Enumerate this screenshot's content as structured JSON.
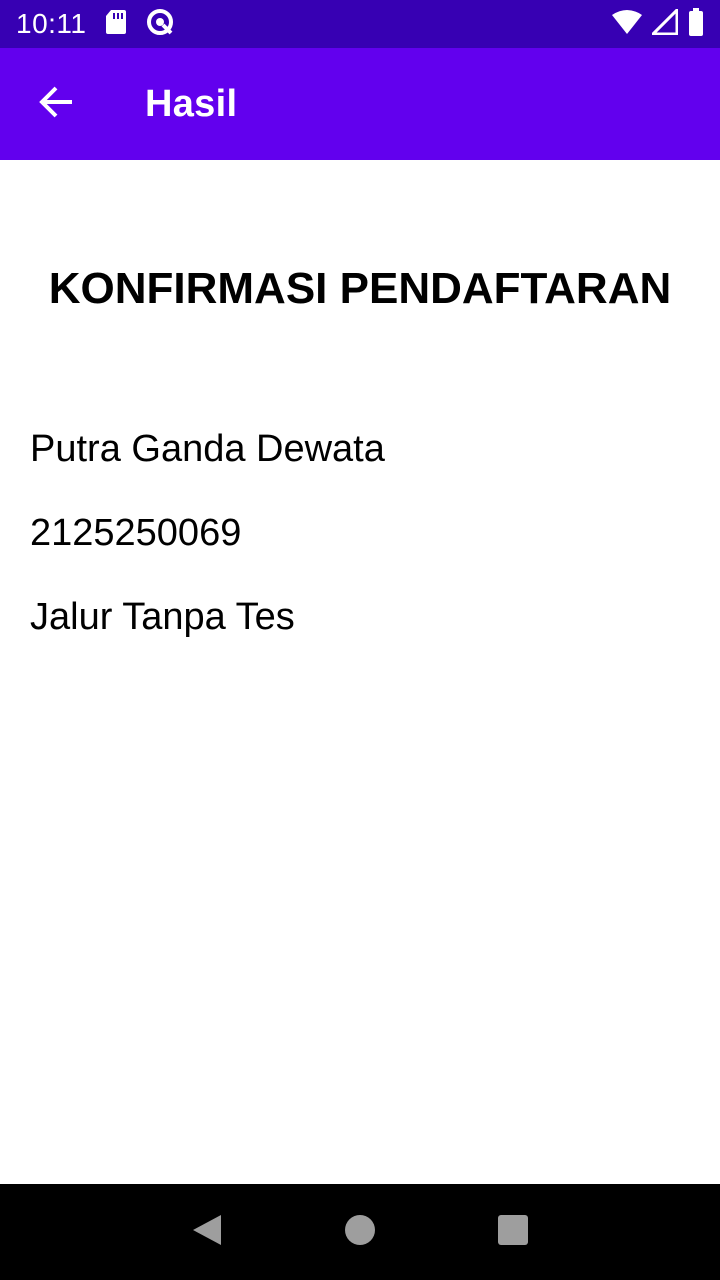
{
  "status_bar": {
    "time": "10:11",
    "icons": [
      "sd-card-icon",
      "vpn-icon",
      "wifi-icon",
      "signal-icon",
      "battery-icon"
    ]
  },
  "app_bar": {
    "title": "Hasil",
    "back_icon": "arrow-back-icon"
  },
  "main": {
    "heading": "KONFIRMASI PENDAFTARAN",
    "name": "Putra Ganda Dewata",
    "id_number": "2125250069",
    "path": "Jalur Tanpa Tes"
  },
  "nav_bar": {
    "buttons": [
      "back-triangle-icon",
      "home-circle-icon",
      "recents-square-icon"
    ]
  },
  "colors": {
    "status_bar": "#3700b3",
    "app_bar": "#6200ee",
    "nav_bar": "#000000",
    "text": "#000000"
  }
}
